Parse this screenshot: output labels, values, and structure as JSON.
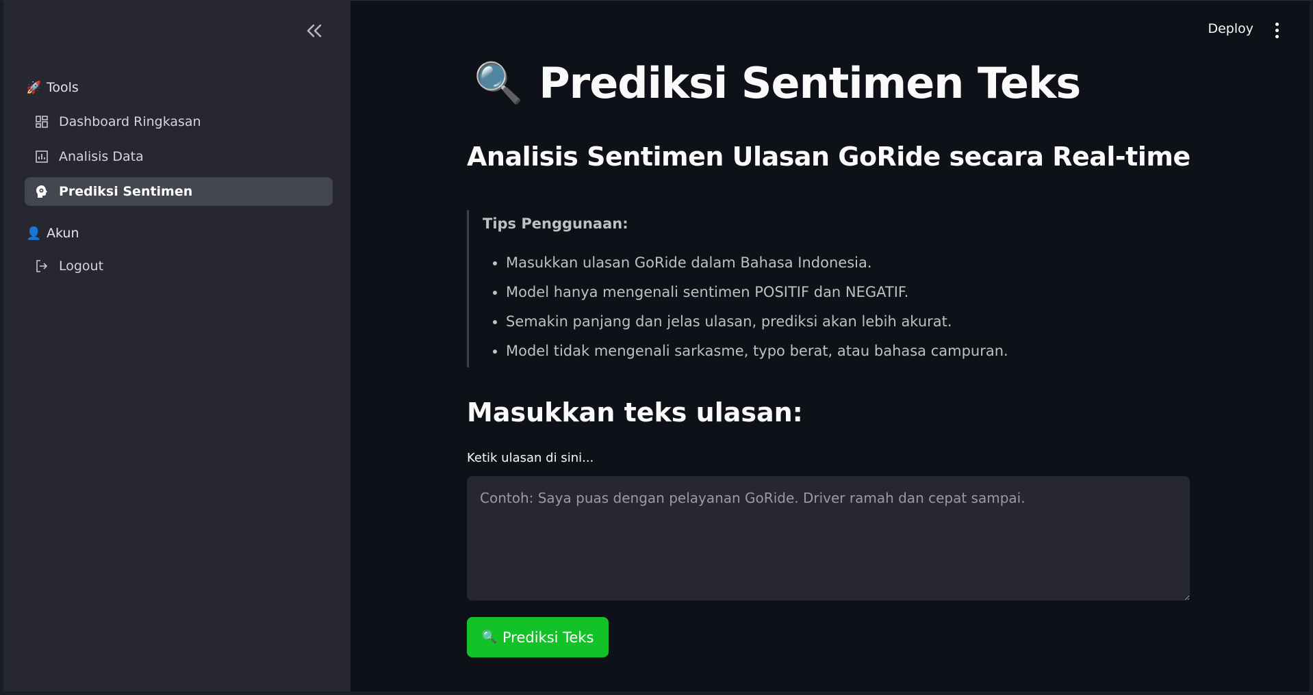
{
  "sidebar": {
    "collapse_label": "«",
    "sections": [
      {
        "emoji": "🚀",
        "title": "Tools"
      },
      {
        "emoji": "👤",
        "title": "Akun"
      }
    ],
    "items": [
      {
        "label": "Dashboard Ringkasan",
        "icon": "dashboard-icon"
      },
      {
        "label": "Analisis Data",
        "icon": "analytics-icon"
      },
      {
        "label": "Prediksi Sentimen",
        "icon": "psychology-icon",
        "active": true
      },
      {
        "label": "Logout",
        "icon": "logout-icon"
      }
    ]
  },
  "header": {
    "deploy_label": "Deploy"
  },
  "main": {
    "title_emoji": "🔍",
    "title": "Prediksi Sentimen Teks",
    "subtitle": "Analisis Sentimen Ulasan GoRide secara Real-time",
    "tips": {
      "title": "Tips Penggunaan:",
      "items": [
        "Masukkan ulasan GoRide dalam Bahasa Indonesia.",
        "Model hanya mengenali sentimen POSITIF dan NEGATIF.",
        "Semakin panjang dan jelas ulasan, prediksi akan lebih akurat.",
        "Model tidak mengenali sarkasme, typo berat, atau bahasa campuran."
      ]
    },
    "input_heading": "Masukkan teks ulasan:",
    "input_label": "Ketik ulasan di sini...",
    "input_value": "",
    "input_placeholder": "Contoh: Saya puas dengan pelayanan GoRide. Driver ramah dan cepat sampai.",
    "button_emoji": "🔍",
    "button_label": "Prediksi Teks"
  },
  "colors": {
    "background": "#0e1117",
    "sidebar": "#262730",
    "active_item": "#43454f",
    "button": "#12c228"
  }
}
